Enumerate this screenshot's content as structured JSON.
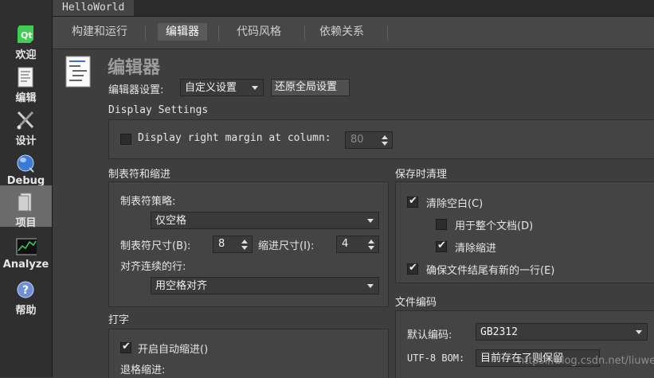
{
  "sidebar": {
    "items": [
      {
        "label": "欢迎",
        "icon": "qt-logo-icon"
      },
      {
        "label": "编辑",
        "icon": "document-icon"
      },
      {
        "label": "设计",
        "icon": "design-tools-icon"
      },
      {
        "label": "Debug",
        "icon": "debug-icon"
      },
      {
        "label": "项目",
        "icon": "project-icon"
      },
      {
        "label": "Analyze",
        "icon": "analyze-icon"
      },
      {
        "label": "帮助",
        "icon": "help-icon"
      }
    ],
    "active": "项目"
  },
  "project": {
    "name": "HelloWorld"
  },
  "tabs": [
    {
      "label": "构建和运行"
    },
    {
      "label": "编辑器"
    },
    {
      "label": "代码风格"
    },
    {
      "label": "依赖关系"
    }
  ],
  "page": {
    "title": "编辑器",
    "settings_label": "编辑器设置:",
    "settings_value": "自定义设置",
    "restore_button": "还原全局设置"
  },
  "display": {
    "title": "Display Settings",
    "margin_label": "Display right margin at column:",
    "margin_value": "80",
    "margin_checked": false
  },
  "tabs_indent": {
    "title": "制表符和缩进",
    "policy_label": "制表符策略:",
    "policy_value": "仅空格",
    "tab_size_label": "制表符尺寸(B):",
    "tab_size": "8",
    "indent_size_label": "缩进尺寸(I):",
    "indent_size": "4",
    "align_label": "对齐连续的行:",
    "align_value": "用空格对齐"
  },
  "typing": {
    "title": "打字",
    "auto_indent_label": "开启自动缩进()",
    "auto_indent_checked": true,
    "backspace_label": "退格缩进:"
  },
  "cleanup": {
    "title": "保存时清理",
    "clean_ws_label": "清除空白(C)",
    "clean_ws_checked": true,
    "entire_doc_label": "用于整个文档(D)",
    "entire_doc_checked": false,
    "clean_indent_label": "清除缩进",
    "clean_indent_checked": true,
    "newline_label": "确保文件结尾有新的一行(E)",
    "newline_checked": true
  },
  "encoding": {
    "title": "文件编码",
    "default_label": "默认编码:",
    "default_value": "GB2312",
    "bom_label": "UTF-8 BOM:",
    "bom_value": "目前存在了则保留"
  },
  "watermark": "https://blog.csdn.net/liuweilhy"
}
